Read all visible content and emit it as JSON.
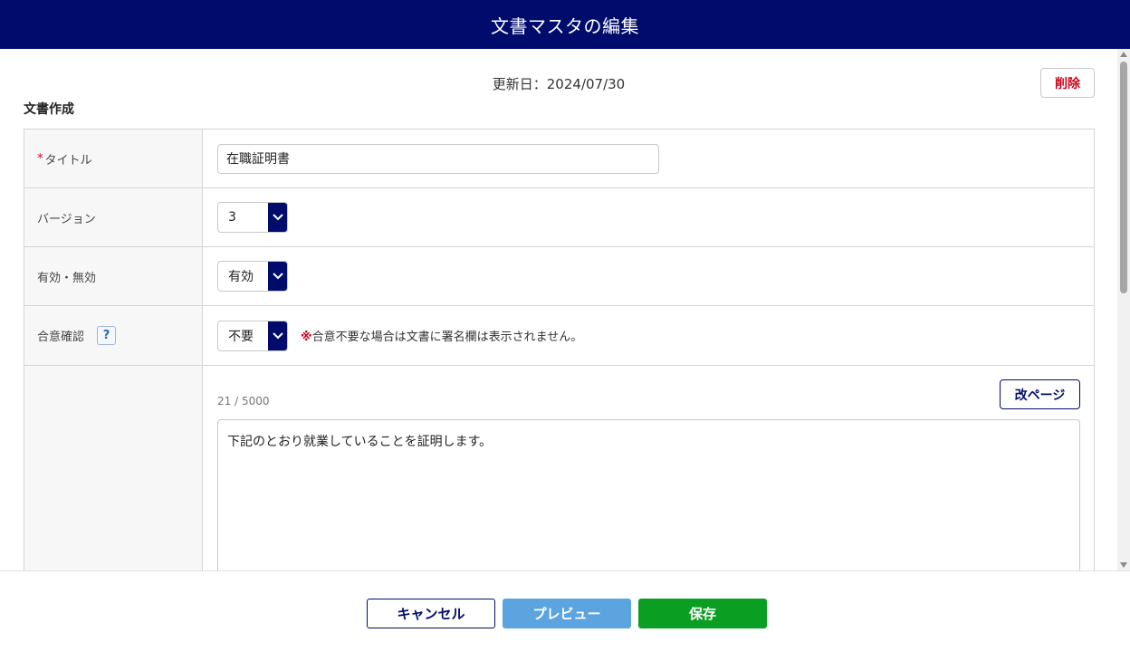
{
  "header": {
    "title": "文書マスタの編集"
  },
  "meta": {
    "updated": "更新日：2024/07/30",
    "delete_label": "削除"
  },
  "section": {
    "title": "文書作成"
  },
  "form": {
    "title_label": "タイトル",
    "required_mark": "*",
    "title_value": "在職証明書",
    "version_label": "バージョン",
    "version_value": "3",
    "active_label": "有効・無効",
    "active_value": "有効",
    "consent_label": "合意確認",
    "help_mark": "?",
    "consent_value": "不要",
    "consent_note_mark": "※",
    "consent_note": "合意不要な場合は文書に署名欄は表示されません。",
    "char_counter": "21 / 5000",
    "page_break_label": "改ページ",
    "body_text": "下記のとおり就業していることを証明します。"
  },
  "footer": {
    "cancel_label": "キャンセル",
    "preview_label": "プレビュー",
    "save_label": "保存"
  },
  "colors": {
    "primary": "#000c6b",
    "danger": "#d0021b",
    "preview": "#5ba4e0",
    "save": "#0a9e22"
  }
}
